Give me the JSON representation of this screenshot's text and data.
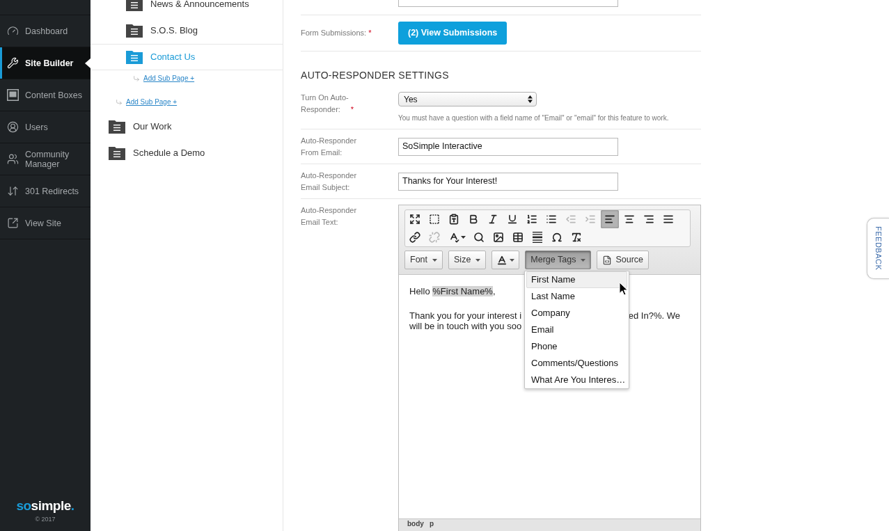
{
  "sidebar": {
    "items": [
      {
        "label": "Dashboard",
        "selected": false
      },
      {
        "label": "Site Builder",
        "selected": true
      },
      {
        "label": "Content Boxes",
        "selected": false
      },
      {
        "label": "Users",
        "selected": false
      },
      {
        "label": "Community Manager",
        "selected": false
      },
      {
        "label": "301 Redirects",
        "selected": false
      },
      {
        "label": "View Site",
        "selected": false
      }
    ],
    "logo": {
      "accent": "so",
      "main": "simple",
      "dot": "."
    },
    "copyright": "© 2017"
  },
  "page_tree": {
    "items": [
      {
        "children": [
          {
            "label": "News & Announcements",
            "selected": false
          },
          {
            "label": "S.O.S. Blog",
            "selected": false
          },
          {
            "label": "Contact Us",
            "selected": true,
            "add_link": "Add Sub Page +"
          }
        ],
        "add_link": "Add Sub Page +"
      },
      {
        "label": "Our Work",
        "selected": false
      },
      {
        "label": "Schedule a Demo",
        "selected": false
      }
    ]
  },
  "form": {
    "rows": [
      {
        "kind": "input"
      },
      {
        "kind": "button",
        "label": "Form Submissions:",
        "required_mark": "*",
        "button": "(2) View Submissions"
      }
    ],
    "section": {
      "heading": "AUTO-RESPONDER SETTINGS",
      "rows": [
        {
          "kind": "select",
          "label": "Turn On Auto-\nResponder:",
          "required_mark": "*",
          "value": "Yes",
          "help": "You must have a question with a field name of \"Email\" or \"email\" for this feature to work."
        },
        {
          "kind": "input",
          "label": "Auto-Responder\nFrom Email:",
          "value": "SoSimple Interactive"
        },
        {
          "kind": "input",
          "label": "Auto-Responder\nEmail Subject:",
          "value": "Thanks for Your Interest!"
        },
        {
          "kind": "editor",
          "label": "Auto-Responder\nEmail Text:",
          "editor": {
            "toolbar": [
              [
                {
                  "kind": "maximize",
                  "on": false,
                  "disabled": false
                },
                {
                  "kind": "showblocks",
                  "on": false,
                  "disabled": false
                },
                {
                  "kind": "pastefromword",
                  "on": false,
                  "disabled": false
                },
                {
                  "kind": "bold",
                  "on": false,
                  "disabled": false
                },
                {
                  "kind": "italic",
                  "on": false,
                  "disabled": false
                },
                {
                  "kind": "underline",
                  "on": false,
                  "disabled": false
                },
                {
                  "kind": "numberedlist",
                  "on": false,
                  "disabled": false
                },
                {
                  "kind": "bulletedlist",
                  "on": false,
                  "disabled": false
                },
                {
                  "kind": "outdent",
                  "on": false,
                  "disabled": true
                },
                {
                  "kind": "indent",
                  "on": false,
                  "disabled": true
                },
                {
                  "kind": "alignleft",
                  "on": true,
                  "disabled": false
                },
                {
                  "kind": "aligncenter",
                  "on": false,
                  "disabled": false
                },
                {
                  "kind": "alignright",
                  "on": false,
                  "disabled": false
                },
                {
                  "kind": "justify",
                  "on": false,
                  "disabled": false
                }
              ],
              [
                {
                  "kind": "link",
                  "on": false,
                  "disabled": false
                },
                {
                  "kind": "unlink",
                  "on": false,
                  "disabled": true
                },
                {
                  "kind": "spellcheck",
                  "on": false,
                  "disabled": false
                },
                {
                  "kind": "find",
                  "on": false,
                  "disabled": false
                },
                {
                  "kind": "image",
                  "on": false,
                  "disabled": false
                },
                {
                  "kind": "table",
                  "on": false,
                  "disabled": false
                },
                {
                  "kind": "horizontalrule",
                  "on": false,
                  "disabled": false
                },
                {
                  "kind": "specialchar",
                  "on": false,
                  "disabled": false
                },
                {
                  "kind": "removeformat",
                  "on": false,
                  "disabled": false
                }
              ]
            ],
            "controls": [
              {
                "kind": "combo",
                "label": "Font",
                "open": false
              },
              {
                "kind": "combo",
                "label": "Size",
                "open": false
              },
              {
                "kind": "color",
                "open": false
              },
              {
                "kind": "combo",
                "label": "Merge Tags",
                "open": true
              },
              {
                "kind": "button",
                "label": "Source",
                "open": false
              }
            ],
            "menu": {
              "items": [
                {
                  "label": "First Name",
                  "hovered": true
                },
                {
                  "label": "Last Name",
                  "hovered": false
                },
                {
                  "label": "Company",
                  "hovered": false
                },
                {
                  "label": "Email",
                  "hovered": false
                },
                {
                  "label": "Phone",
                  "hovered": false
                },
                {
                  "label": "Comments/Questions",
                  "hovered": false
                },
                {
                  "label": "What Are You Interes…",
                  "hovered": false
                }
              ]
            },
            "content": {
              "greeting": [
                {
                  "text": "Hello ",
                  "highlighted": false
                },
                {
                  "text": "%First Name%",
                  "highlighted": true
                },
                {
                  "text": ",",
                  "highlighted": false
                }
              ],
              "paragraph_lines": [
                [
                  "Thank you for your interest i",
                  "ed In?%. We"
                ],
                [
                  "will be in touch with you soo"
                ]
              ]
            },
            "path": [
              "body",
              "p"
            ]
          }
        }
      ]
    }
  },
  "feedback_tab": {
    "label": "FEEDBACK"
  }
}
